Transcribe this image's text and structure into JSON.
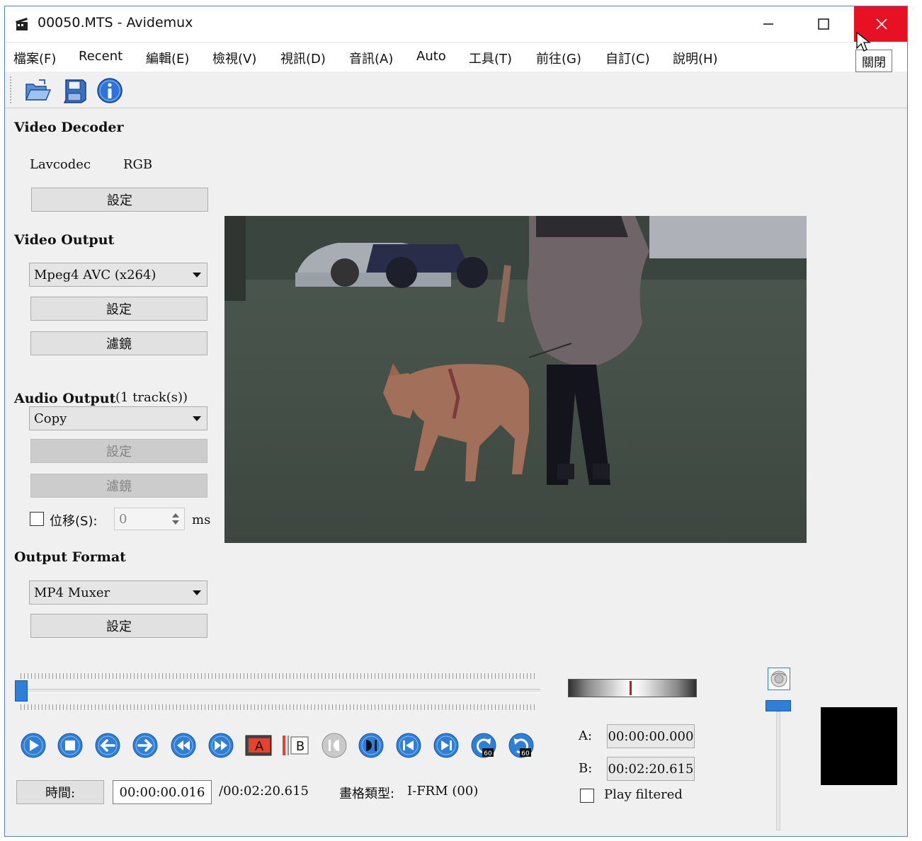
{
  "window": {
    "title": "00050.MTS - Avidemux",
    "close_tooltip": "關閉"
  },
  "menu": [
    {
      "label": "檔案(F)"
    },
    {
      "label": "Recent"
    },
    {
      "label": "編輯(E)"
    },
    {
      "label": "檢視(V)"
    },
    {
      "label": "視訊(D)"
    },
    {
      "label": "音訊(A)"
    },
    {
      "label": "Auto"
    },
    {
      "label": "工具(T)"
    },
    {
      "label": "前往(G)"
    },
    {
      "label": "自訂(C)"
    },
    {
      "label": "說明(H)"
    }
  ],
  "toolbar": {
    "icons": [
      "open-folder-icon",
      "save-disk-icon",
      "info-icon"
    ]
  },
  "video_decoder": {
    "title": "Video Decoder",
    "decoder": "Lavcodec",
    "colorspace": "RGB",
    "settings_label": "設定"
  },
  "video_output": {
    "title": "Video Output",
    "codec": "Mpeg4 AVC (x264)",
    "settings_label": "設定",
    "filters_label": "濾鏡"
  },
  "audio_output": {
    "title": "Audio Output",
    "tracks": "(1 track(s))",
    "codec": "Copy",
    "settings_label": "設定",
    "filters_label": "濾鏡",
    "shift_label": "位移(S):",
    "shift_value": "0",
    "shift_unit": "ms"
  },
  "output_format": {
    "title": "Output Format",
    "muxer": "MP4 Muxer",
    "settings_label": "設定"
  },
  "navigation": {
    "seek_position": 0.0,
    "buttons": [
      "play-icon",
      "stop-icon",
      "previous-frame-icon",
      "next-frame-icon",
      "rewind-icon",
      "fast-forward-icon",
      "marker-a-icon",
      "marker-b-icon",
      "goto-marker-a-icon",
      "goto-marker-b-icon",
      "previous-keyframe-icon",
      "next-keyframe-icon",
      "back-60-icon",
      "forward-60-icon"
    ],
    "marker_a_label": "A",
    "marker_b_label": "B"
  },
  "status": {
    "time_button": "時間:",
    "current_time": "00:00:00.016",
    "total_time": "/00:02:20.615",
    "frame_type_label": "畫格類型:",
    "frame_type_value": "I-FRM (00)"
  },
  "selection": {
    "a_label": "A:",
    "a_value": "00:00:00.000",
    "b_label": "B:",
    "b_value": "00:02:20.615",
    "play_filtered_label": "Play filtered"
  },
  "colors": {
    "accent": "#2f7fd7",
    "close_red": "#e81123",
    "marker_red": "#e8412c"
  }
}
